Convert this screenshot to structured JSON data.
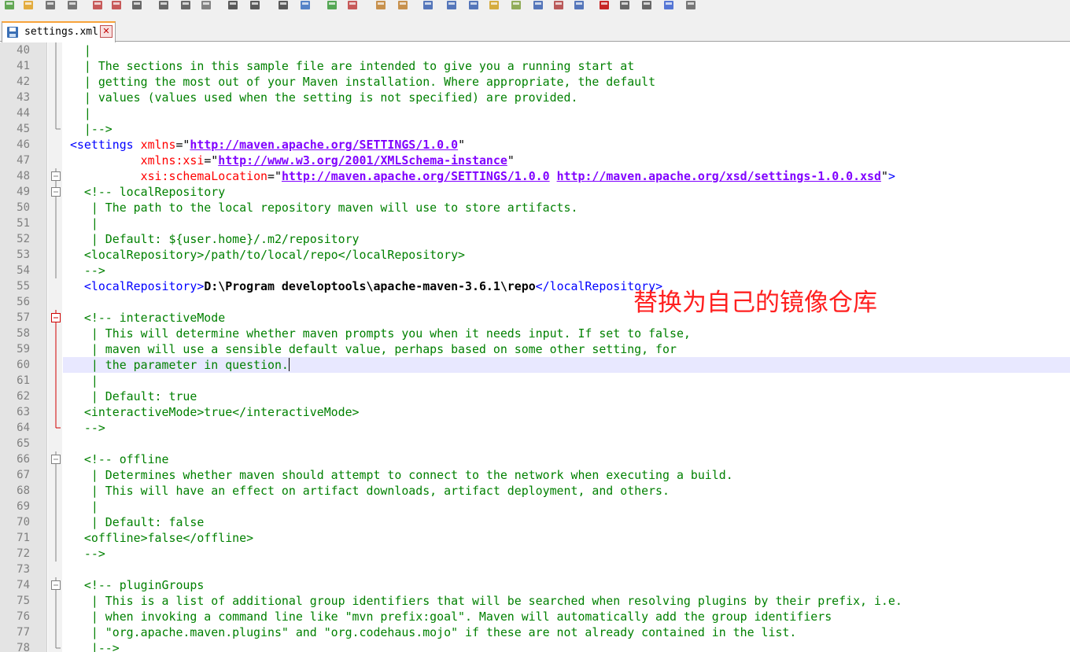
{
  "tab": {
    "filename": "settings.xml"
  },
  "toolbar_icons": [
    "new-file-icon",
    "open-file-icon",
    "save-icon",
    "save-all-icon",
    "close-icon",
    "close-all-icon",
    "print-icon",
    "cut-icon",
    "copy-icon",
    "paste-icon",
    "undo-icon",
    "redo-icon",
    "find-icon",
    "replace-icon",
    "zoom-in-icon",
    "zoom-out-icon",
    "sync-vertical-icon",
    "sync-horizontal-icon",
    "word-wrap-icon",
    "show-all-chars-icon",
    "indent-guide-icon",
    "user-language-icon",
    "doc-map-icon",
    "function-list-icon",
    "folder-workspace-icon",
    "monitor-icon",
    "record-macro-icon",
    "stop-macro-icon",
    "play-macro-icon",
    "run-macro-multiple-icon",
    "save-macro-icon"
  ],
  "annotation": "替换为自己的镜像仓库",
  "lines": [
    {
      "n": "40",
      "segs": [
        [
          "c-com",
          "   |"
        ]
      ]
    },
    {
      "n": "41",
      "segs": [
        [
          "c-com",
          "   | The sections in this sample file are intended to give you a running start at"
        ]
      ]
    },
    {
      "n": "42",
      "segs": [
        [
          "c-com",
          "   | getting the most out of your Maven installation. Where appropriate, the default"
        ]
      ]
    },
    {
      "n": "43",
      "segs": [
        [
          "c-com",
          "   | values (values used when the setting is not specified) are provided."
        ]
      ]
    },
    {
      "n": "44",
      "segs": [
        [
          "c-com",
          "   |"
        ]
      ]
    },
    {
      "n": "45",
      "segs": [
        [
          "c-com",
          "   |-->"
        ]
      ]
    },
    {
      "n": "46",
      "segs": [
        [
          "c-tag",
          " <settings "
        ],
        [
          "c-attr",
          "xmlns"
        ],
        [
          "c-plain",
          "=\""
        ],
        [
          "c-str",
          "http://maven.apache.org/SETTINGS/1.0.0"
        ],
        [
          "c-plain",
          "\""
        ]
      ]
    },
    {
      "n": "47",
      "segs": [
        [
          "c-plain",
          "           "
        ],
        [
          "c-attr",
          "xmlns:xsi"
        ],
        [
          "c-plain",
          "=\""
        ],
        [
          "c-str",
          "http://www.w3.org/2001/XMLSchema-instance"
        ],
        [
          "c-plain",
          "\""
        ]
      ]
    },
    {
      "n": "48",
      "segs": [
        [
          "c-plain",
          "           "
        ],
        [
          "c-attr",
          "xsi:schemaLocation"
        ],
        [
          "c-plain",
          "=\""
        ],
        [
          "c-str",
          "http://maven.apache.org/SETTINGS/1.0.0"
        ],
        [
          "c-plain",
          " "
        ],
        [
          "c-str",
          "http://maven.apache.org/xsd/settings-1.0.0.xsd"
        ],
        [
          "c-plain",
          "\""
        ],
        [
          "c-tag",
          ">"
        ]
      ]
    },
    {
      "n": "49",
      "segs": [
        [
          "c-com",
          "   <!-- localRepository"
        ]
      ]
    },
    {
      "n": "50",
      "segs": [
        [
          "c-com",
          "    | The path to the local repository maven will use to store artifacts."
        ]
      ]
    },
    {
      "n": "51",
      "segs": [
        [
          "c-com",
          "    |"
        ]
      ]
    },
    {
      "n": "52",
      "segs": [
        [
          "c-com",
          "    | Default: ${user.home}/.m2/repository"
        ]
      ]
    },
    {
      "n": "53",
      "segs": [
        [
          "c-com",
          "   <localRepository>/path/to/local/repo</localRepository>"
        ]
      ]
    },
    {
      "n": "54",
      "segs": [
        [
          "c-com",
          "   -->"
        ]
      ]
    },
    {
      "n": "55",
      "segs": [
        [
          "c-tag",
          "   <localRepository>"
        ],
        [
          "c-txt",
          "D:\\Program developtools\\apache-maven-3.6.1\\repo"
        ],
        [
          "c-tag",
          "</localRepository>"
        ]
      ]
    },
    {
      "n": "56",
      "segs": [
        [
          "c-plain",
          ""
        ]
      ]
    },
    {
      "n": "57",
      "segs": [
        [
          "c-com",
          "   <!-- interactiveMode"
        ]
      ]
    },
    {
      "n": "58",
      "segs": [
        [
          "c-com",
          "    | This will determine whether maven prompts you when it needs input. If set to false,"
        ]
      ]
    },
    {
      "n": "59",
      "segs": [
        [
          "c-com",
          "    | maven will use a sensible default value, perhaps based on some other setting, for"
        ]
      ]
    },
    {
      "n": "60",
      "segs": [
        [
          "c-com",
          "    | the parameter in question."
        ]
      ]
    },
    {
      "n": "61",
      "segs": [
        [
          "c-com",
          "    |"
        ]
      ]
    },
    {
      "n": "62",
      "segs": [
        [
          "c-com",
          "    | Default: true"
        ]
      ]
    },
    {
      "n": "63",
      "segs": [
        [
          "c-com",
          "   <interactiveMode>true</interactiveMode>"
        ]
      ]
    },
    {
      "n": "64",
      "segs": [
        [
          "c-com",
          "   -->"
        ]
      ]
    },
    {
      "n": "65",
      "segs": [
        [
          "c-plain",
          ""
        ]
      ]
    },
    {
      "n": "66",
      "segs": [
        [
          "c-com",
          "   <!-- offline"
        ]
      ]
    },
    {
      "n": "67",
      "segs": [
        [
          "c-com",
          "    | Determines whether maven should attempt to connect to the network when executing a build."
        ]
      ]
    },
    {
      "n": "68",
      "segs": [
        [
          "c-com",
          "    | This will have an effect on artifact downloads, artifact deployment, and others."
        ]
      ]
    },
    {
      "n": "69",
      "segs": [
        [
          "c-com",
          "    |"
        ]
      ]
    },
    {
      "n": "70",
      "segs": [
        [
          "c-com",
          "    | Default: false"
        ]
      ]
    },
    {
      "n": "71",
      "segs": [
        [
          "c-com",
          "   <offline>false</offline>"
        ]
      ]
    },
    {
      "n": "72",
      "segs": [
        [
          "c-com",
          "   -->"
        ]
      ]
    },
    {
      "n": "73",
      "segs": [
        [
          "c-plain",
          ""
        ]
      ]
    },
    {
      "n": "74",
      "segs": [
        [
          "c-com",
          "   <!-- pluginGroups"
        ]
      ]
    },
    {
      "n": "75",
      "segs": [
        [
          "c-com",
          "    | This is a list of additional group identifiers that will be searched when resolving plugins by their prefix, i.e."
        ]
      ]
    },
    {
      "n": "76",
      "segs": [
        [
          "c-com",
          "    | when invoking a command line like \"mvn prefix:goal\". Maven will automatically add the group identifiers"
        ]
      ]
    },
    {
      "n": "77",
      "segs": [
        [
          "c-com",
          "    | \"org.apache.maven.plugins\" and \"org.codehaus.mojo\" if these are not already contained in the list."
        ]
      ]
    },
    {
      "n": "78",
      "segs": [
        [
          "c-com",
          "    |-->"
        ]
      ]
    }
  ]
}
